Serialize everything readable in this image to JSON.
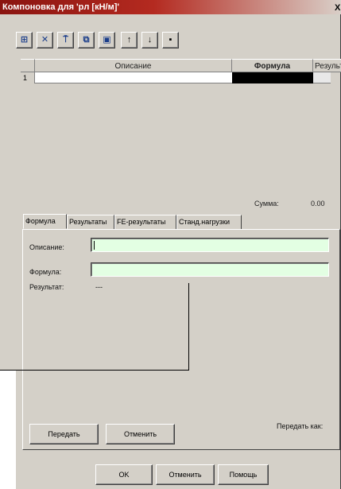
{
  "window": {
    "title": "Компоновка для 'pл [кН/м]'",
    "close_label": "X"
  },
  "toolbar": {
    "buttons": [
      {
        "name": "insert-row-icon",
        "glyph": "⊞"
      },
      {
        "name": "delete-row-icon",
        "glyph": "✕"
      },
      {
        "name": "filter-icon",
        "glyph": "⍑"
      },
      {
        "name": "copy-icon",
        "glyph": "⧉"
      },
      {
        "name": "paste-icon",
        "glyph": "▣"
      },
      {
        "name": "move-up-icon",
        "glyph": "↑"
      },
      {
        "name": "move-down-icon",
        "glyph": "↓"
      },
      {
        "name": "save-icon",
        "glyph": "▪"
      }
    ]
  },
  "grid": {
    "columns": [
      "Описание",
      "Формула",
      "Результа"
    ],
    "rows": [
      {
        "num": "1",
        "description": "",
        "formula": "",
        "result": ""
      }
    ]
  },
  "sum": {
    "label": "Сумма:",
    "value": "0.00"
  },
  "tabs": [
    "Формула",
    "Результаты",
    "FE-результаты",
    "Станд.нагрузки"
  ],
  "form": {
    "description_label": "Описание:",
    "description_value": "",
    "formula_label": "Формула:",
    "formula_value": "",
    "result_label": "Результат:",
    "result_value": "---"
  },
  "actions": {
    "transfer": "Передать",
    "cancel": "Отменить",
    "transfer_as": "Передать как:"
  },
  "dialog": {
    "ok": "OK",
    "cancel": "Отменить",
    "help": "Помощь"
  },
  "colors": {
    "title_start": "#8a1410",
    "input_bg": "#e3ffe3",
    "dialog_bg": "#d4d0c8"
  }
}
